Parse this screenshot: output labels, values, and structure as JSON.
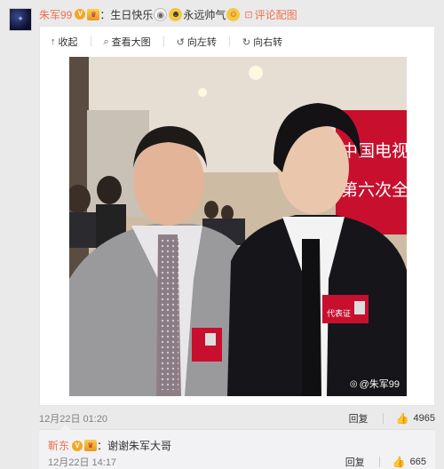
{
  "comment": {
    "avatar_icon": "user-avatar-icon",
    "username": "朱军99",
    "separator": "：",
    "text_1": "生日快乐",
    "emoji_1": "cake-icon",
    "text_2": "永远帅气",
    "emoji_2": "laugh-icon",
    "action_label": "评论配图",
    "timestamp": "12月22日 01:20",
    "reply_label": "回复",
    "like_count": "4965"
  },
  "media_toolbar": {
    "collapse_label": "收起",
    "view_large_label": "查看大图",
    "rotate_left_label": "向左转",
    "rotate_right_label": "向右转"
  },
  "photo": {
    "banner_text_1": "中国电视",
    "banner_text_2": "第六次全",
    "badge_text": "代表证",
    "watermark": "@朱军99"
  },
  "reply": {
    "username": "靳东",
    "separator": "：",
    "text": "谢谢朱军大哥",
    "timestamp": "12月22日 14:17",
    "reply_label": "回复",
    "like_count": "665"
  },
  "colors": {
    "username": "#eb7350",
    "meta": "#808080",
    "reply_bg": "#f2f2f5"
  }
}
